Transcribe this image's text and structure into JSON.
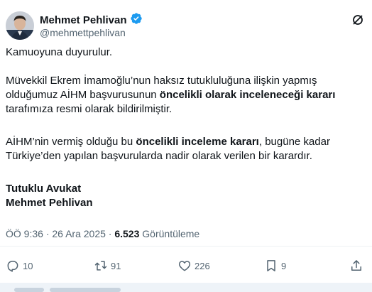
{
  "author": {
    "display_name": "Mehmet Pehlivan",
    "handle": "@mehmettpehlivan",
    "verified": true,
    "verified_color": "#1d9bf0"
  },
  "post": {
    "para1": "Kamuoyuna duyurulur.",
    "para2_a": "Müvekkil Ekrem İmamoğlu’nun haksız tutukluluğuna ilişkin yapmış olduğumuz AİHM başvurusunun ",
    "para2_b": "öncelikli olarak inceleneceği kararı",
    "para2_c": " tarafımıza resmi olarak bildirilmiştir.",
    "para3_a": "AİHM’nin vermiş olduğu bu ",
    "para3_b": "öncelikli inceleme kararı",
    "para3_c": ", bugüne kadar Türkiye’den yapılan başvurularda nadir olarak verilen bir karardır.",
    "signature_line1": "Tutuklu Avukat",
    "signature_line2": "Mehmet Pehlivan"
  },
  "meta": {
    "time": "ÖÖ 9:36",
    "date": "26 Ara 2025",
    "views_count": "6.523",
    "views_label": "Görüntüleme"
  },
  "actions": {
    "replies": "10",
    "reposts": "91",
    "likes": "226",
    "bookmarks": "9"
  },
  "icons": [
    "more-icon",
    "verified-icon",
    "reply-icon",
    "repost-icon",
    "like-icon",
    "bookmark-icon",
    "share-icon"
  ]
}
